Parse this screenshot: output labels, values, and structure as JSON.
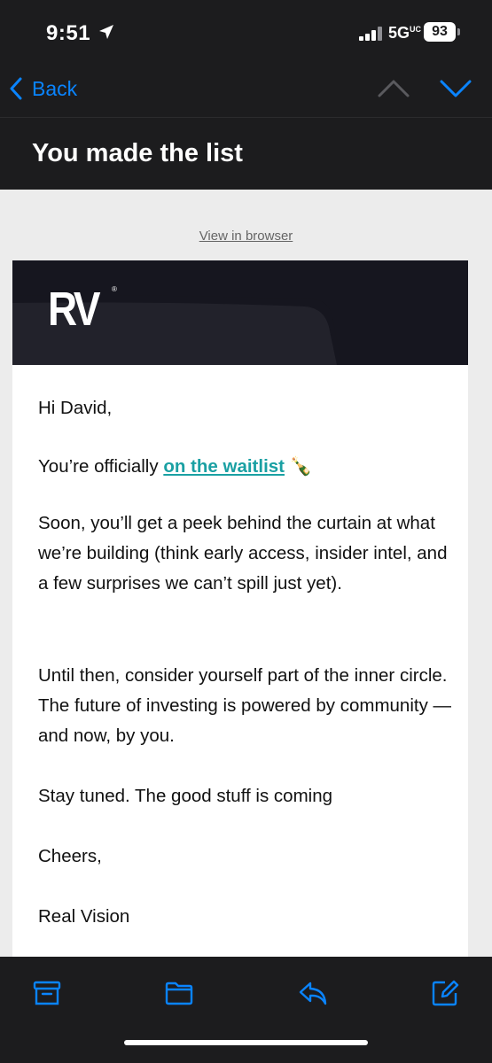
{
  "status_bar": {
    "time": "9:51",
    "network": "5G",
    "network_sup": "UC",
    "battery": "93"
  },
  "nav": {
    "back_label": "Back"
  },
  "email": {
    "subject": "You made the list",
    "view_in_browser": "View in browser",
    "logo_text": "RV",
    "logo_mark": "®",
    "greeting": "Hi David,",
    "line1_prefix": "You’re officially ",
    "line1_link": "on the waitlist",
    "line1_emoji": "🍾",
    "para2": "Soon, you’ll get a peek behind the curtain at what we’re building (think early access, insider intel, and a few surprises we can’t spill just yet).",
    "para3": "Until then, consider yourself part of the inner circle. The future of investing is powered by community — and now, by you.",
    "para4": "Stay tuned. The good stuff is coming",
    "para5": "Cheers,",
    "signature": "Real Vision"
  },
  "toolbar": {
    "icons": [
      "archive-icon",
      "folder-icon",
      "reply-icon",
      "compose-icon"
    ]
  },
  "colors": {
    "accent": "#0a84ff",
    "link": "#1aa0a3",
    "chrome": "#1c1c1e"
  }
}
